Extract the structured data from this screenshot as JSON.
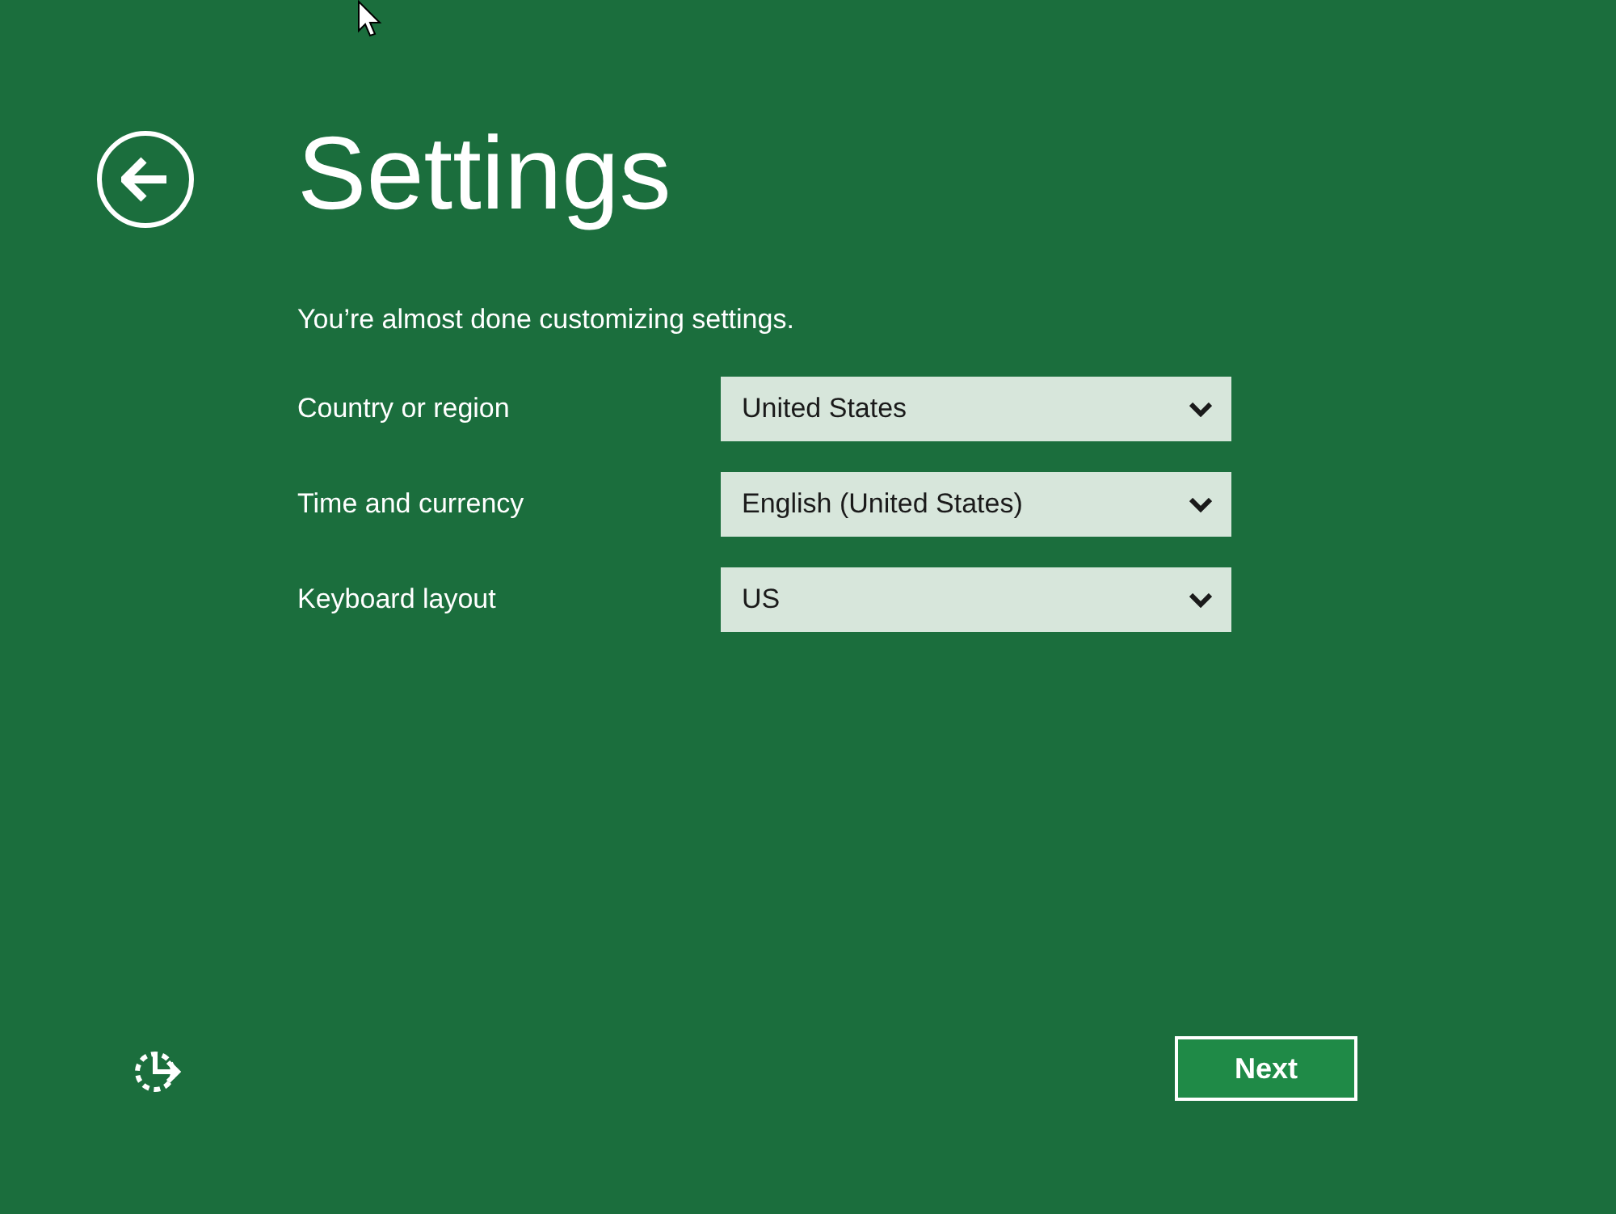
{
  "title": "Settings",
  "subtitle": "You’re almost done customizing settings.",
  "fields": [
    {
      "label": "Country or region",
      "value": "United States"
    },
    {
      "label": "Time and currency",
      "value": "English (United States)"
    },
    {
      "label": "Keyboard layout",
      "value": "US"
    }
  ],
  "buttons": {
    "next": "Next"
  }
}
